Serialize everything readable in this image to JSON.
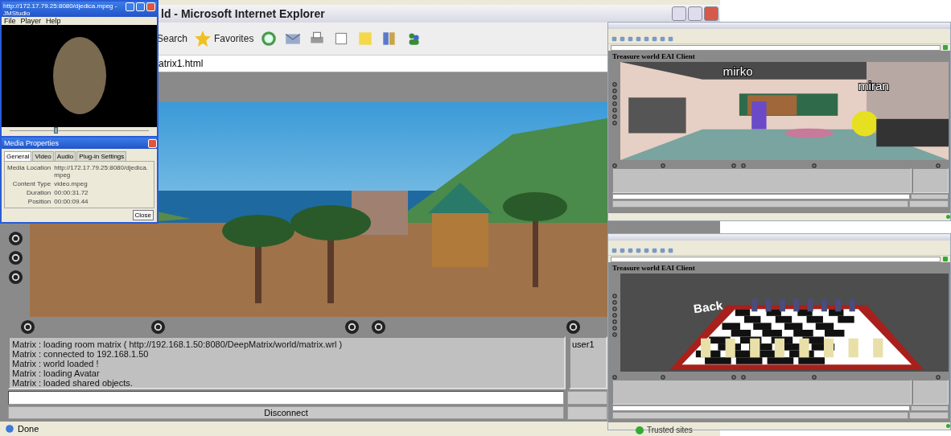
{
  "media_player": {
    "title": "http://172.17.79.25:8080/djedica.mpeg - JMStudio",
    "menu": [
      "File",
      "Player",
      "Help"
    ],
    "seek": {
      "level": 0.32
    }
  },
  "media_properties": {
    "title": "Media Properties",
    "tabs": [
      {
        "label": "General",
        "selected": true
      },
      {
        "label": "Video",
        "selected": false
      },
      {
        "label": "Audio",
        "selected": false
      },
      {
        "label": "Plug-in Settings",
        "selected": false
      }
    ],
    "fields": [
      {
        "label": "Media Location",
        "value": "http://172.17.79.25:8080/djedica.mpeg"
      },
      {
        "label": "Content Type",
        "value": "video.mpeg"
      },
      {
        "label": "Duration",
        "value": "00:00:31.72"
      },
      {
        "label": "Position",
        "value": "00:00:09.44"
      }
    ],
    "close": "Close"
  },
  "browser": {
    "title": "ld - Microsoft Internet Explorer",
    "toolbar": [
      "Search",
      "Favorites"
    ],
    "address": "atrix1.html",
    "log": [
      "Matrix : loading room matrix ( http://192.168.1.50:8080/DeepMatrix/world/matrix.wrl )",
      "Matrix : connected to 192.168.1.50",
      "Matrix : world loaded !",
      "Matrix : loading Avatar",
      "Matrix : loaded shared objects."
    ],
    "users": [
      "user1"
    ],
    "disconnect": "Disconnect",
    "status": "Done"
  },
  "clients": [
    {
      "heading": "Treasure world EAI Client",
      "kind": "room",
      "labels": [
        "mirko",
        "miran"
      ]
    },
    {
      "heading": "Treasure world EAI Client",
      "kind": "chess",
      "labels": [
        "Back"
      ]
    }
  ],
  "desktop_zone": "Trusted sites"
}
